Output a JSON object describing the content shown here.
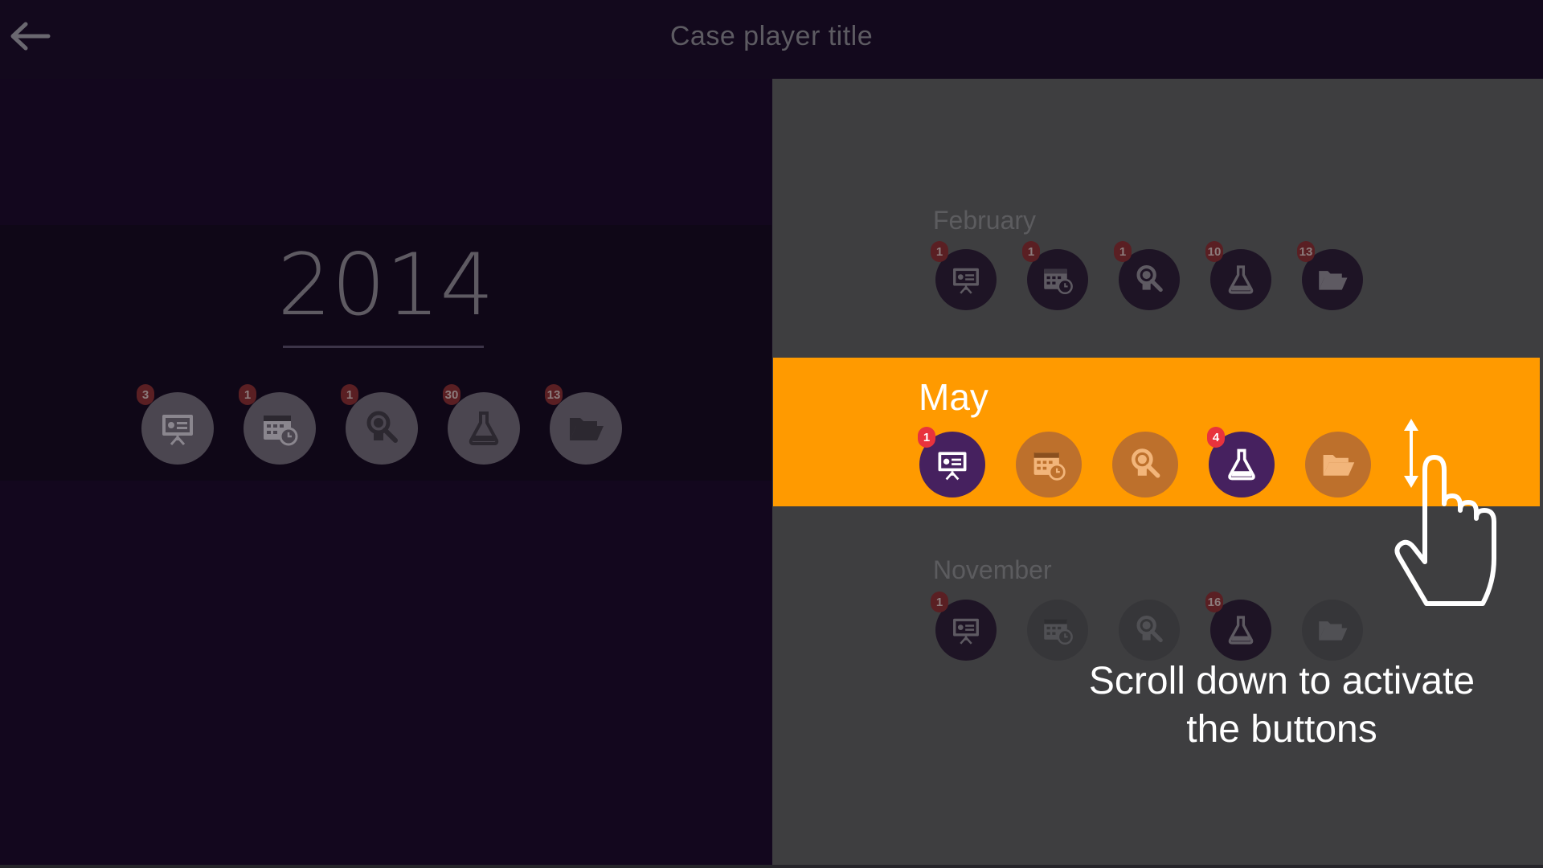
{
  "header": {
    "title": "Case player title",
    "back_icon": "arrow-left-icon"
  },
  "year_panel": {
    "year": "2014",
    "buttons": [
      {
        "icon": "presentation-icon",
        "badge": "3"
      },
      {
        "icon": "calendar-clock-icon",
        "badge": "1"
      },
      {
        "icon": "magnifier-icon",
        "badge": "1"
      },
      {
        "icon": "flask-icon",
        "badge": "30"
      },
      {
        "icon": "folder-icon",
        "badge": "13"
      }
    ]
  },
  "months": {
    "february": {
      "label": "February",
      "buttons": [
        {
          "icon": "presentation-icon",
          "badge": "1"
        },
        {
          "icon": "calendar-clock-icon",
          "badge": "1"
        },
        {
          "icon": "magnifier-icon",
          "badge": "1"
        },
        {
          "icon": "flask-icon",
          "badge": "10"
        },
        {
          "icon": "folder-icon",
          "badge": "13"
        }
      ]
    },
    "may": {
      "label": "May",
      "buttons": [
        {
          "icon": "presentation-icon",
          "badge": "1",
          "active": true
        },
        {
          "icon": "calendar-clock-icon",
          "badge": "",
          "active": false
        },
        {
          "icon": "magnifier-icon",
          "badge": "",
          "active": false
        },
        {
          "icon": "flask-icon",
          "badge": "4",
          "active": true
        },
        {
          "icon": "folder-icon",
          "badge": "",
          "active": false
        }
      ]
    },
    "november": {
      "label": "November",
      "buttons": [
        {
          "icon": "presentation-icon",
          "badge": "1"
        },
        {
          "icon": "calendar-clock-icon",
          "badge": ""
        },
        {
          "icon": "magnifier-icon",
          "badge": ""
        },
        {
          "icon": "flask-icon",
          "badge": "16"
        },
        {
          "icon": "folder-icon",
          "badge": ""
        }
      ]
    }
  },
  "hint": {
    "line1": "Scroll down to activate",
    "line2": "the buttons",
    "icons": [
      "scroll-arrow-icon",
      "pointing-hand-icon"
    ]
  },
  "colors": {
    "accent": "#ff9a00",
    "active_button": "#46215f",
    "badge": "#e8333d",
    "background": "#14081f",
    "right_panel": "#3e3e40"
  }
}
